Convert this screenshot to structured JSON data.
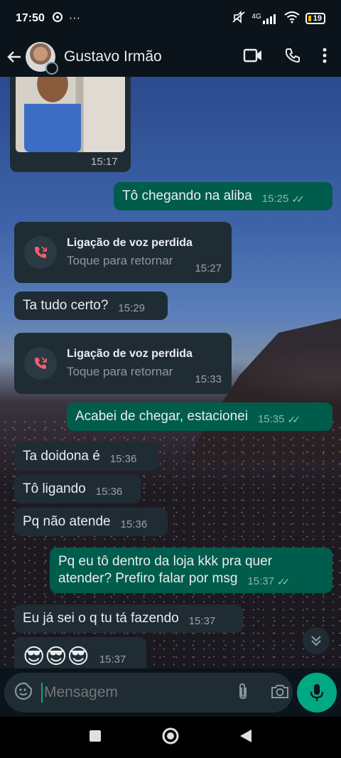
{
  "status_bar": {
    "time": "17:50",
    "more": "···",
    "network": "4G",
    "battery": "19"
  },
  "header": {
    "contact_name": "Gustavo Irmão"
  },
  "messages": {
    "photo_time": "15:17",
    "m1": {
      "text": "Tô chegando na aliba",
      "time": "15:25"
    },
    "call1": {
      "title": "Ligação de voz perdida",
      "subtitle": "Toque para retornar",
      "time": "15:27"
    },
    "m2": {
      "text": "Ta tudo certo?",
      "time": "15:29"
    },
    "call2": {
      "title": "Ligação de voz perdida",
      "subtitle": "Toque para retornar",
      "time": "15:33"
    },
    "m3": {
      "text": "Acabei de chegar, estacionei",
      "time": "15:35"
    },
    "m4": {
      "text": "Ta doidona é",
      "time": "15:36"
    },
    "m5": {
      "text": "Tô ligando",
      "time": "15:36"
    },
    "m6": {
      "text": "Pq não atende",
      "time": "15:36"
    },
    "m7": {
      "text": "Pq eu tô dentro da loja kkk pra quer atender? Prefiro falar por msg",
      "time": "15:37"
    },
    "m8": {
      "text": "Eu já sei o q tu tá fazendo",
      "time": "15:37"
    },
    "m9": {
      "text": "😎😎😎",
      "time": "15:37"
    }
  },
  "input": {
    "placeholder": "Mensagem"
  },
  "colors": {
    "incoming_bubble": "#1f2c34",
    "outgoing_bubble": "#005c4b",
    "accent": "#00a884",
    "missed_call": "#f15c6d"
  }
}
